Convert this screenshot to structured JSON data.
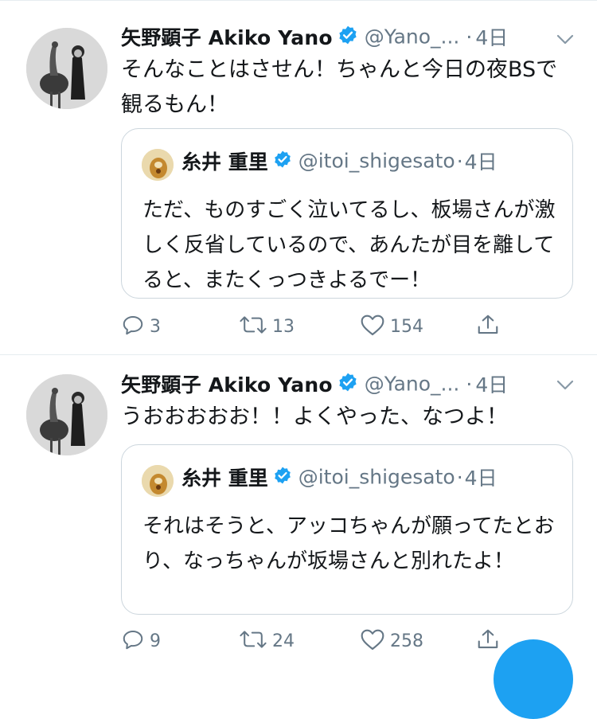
{
  "tweets": [
    {
      "author_name": "矢野顕子 Akiko Yano",
      "handle": "@Yano_...",
      "time": "4日",
      "text": "そんなことはさせん！ちゃんと今日の夜BSで観るもん！",
      "quote": {
        "name": "糸井 重里",
        "handle": "@itoi_shigesato",
        "time": "4日",
        "text": "ただ、ものすごく泣いてるし、板場さんが激しく反省しているので、あんたが目を離してると、またくっつきよるでー！"
      },
      "actions": {
        "replies": "3",
        "retweets": "13",
        "likes": "154"
      }
    },
    {
      "author_name": "矢野顕子 Akiko Yano",
      "handle": "@Yano_...",
      "time": "4日",
      "text": "うおおおおお！！よくやった、なつよ！",
      "quote": {
        "name": "糸井 重里",
        "handle": "@itoi_shigesato",
        "time": "4日",
        "text": "それはそうと、アッコちゃんが願ってたとおり、なっちゃんが坂場さんと別れたよ！"
      },
      "actions": {
        "replies": "9",
        "retweets": "24",
        "likes": "258"
      }
    }
  ],
  "colors": {
    "primary_text": "#14171a",
    "secondary_text": "#657786",
    "verified_blue": "#1da1f2",
    "border": "#ccd6dd",
    "fab": "#1da1f2"
  },
  "icons": [
    "verified-badge-icon",
    "chevron-down-icon",
    "reply-icon",
    "retweet-icon",
    "like-icon",
    "share-icon"
  ]
}
